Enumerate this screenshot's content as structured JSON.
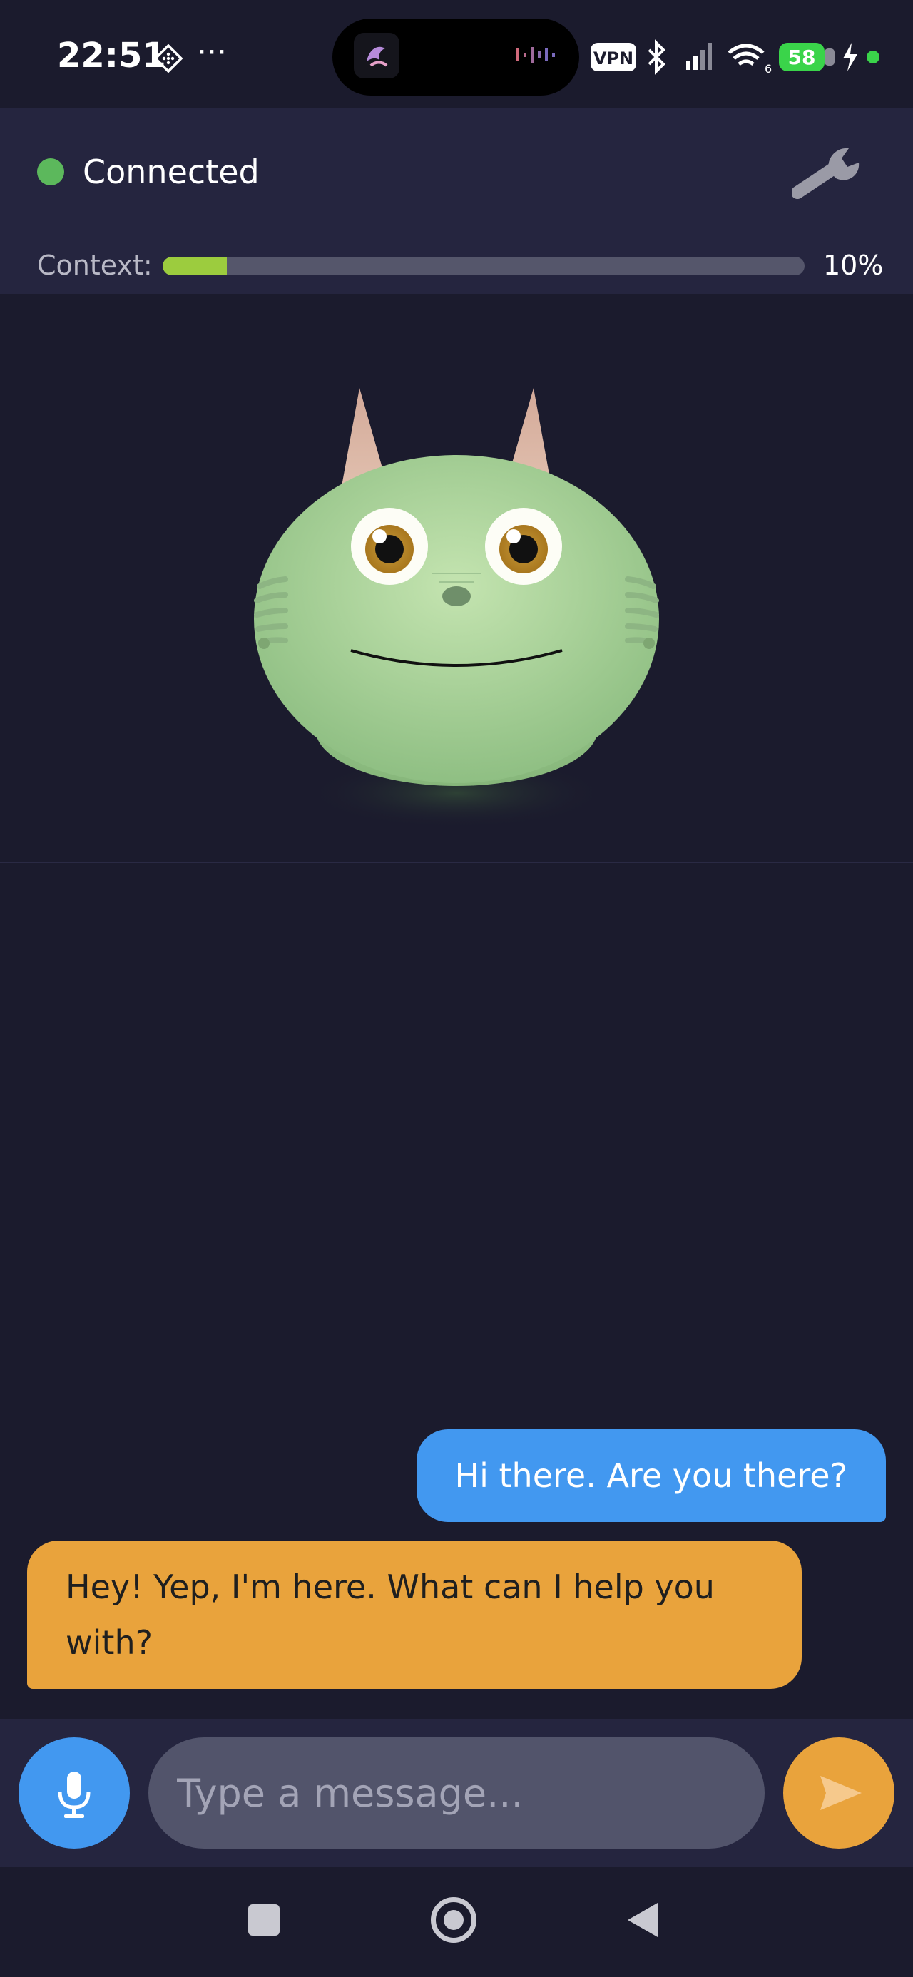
{
  "status_bar": {
    "time": "22:51",
    "more": "···",
    "vpn": "VPN",
    "wifi_generation": "6",
    "battery": "58",
    "icons": [
      "diamond-icon",
      "app-icon",
      "audio-wave-icon",
      "vpn-icon",
      "bluetooth-icon",
      "signal-icon",
      "wifi-icon",
      "battery-icon",
      "charging-icon",
      "active-dot-icon"
    ]
  },
  "header": {
    "status": "Connected",
    "status_color": "#5cb85c",
    "settings_icon": "wrench-icon",
    "context_label": "Context:",
    "context_value": 0.1,
    "context_text": "10%",
    "context_color": "#9ccc3e"
  },
  "avatar": {
    "name": "cat-avatar",
    "body_color": "#a8d49a",
    "ear_color": "#d9b3a4"
  },
  "messages": [
    {
      "role": "user",
      "text": "Hi there. Are you there?",
      "color": "#4298f0"
    },
    {
      "role": "assistant",
      "text": "Hey! Yep, I'm here. What can I help you with?",
      "color": "#e9a33c"
    }
  ],
  "composer": {
    "placeholder": "Type a message...",
    "value": "",
    "mic_icon": "microphone-icon",
    "send_icon": "send-icon"
  },
  "navbar": {
    "icons": [
      "recents-icon",
      "home-icon",
      "back-icon"
    ]
  }
}
